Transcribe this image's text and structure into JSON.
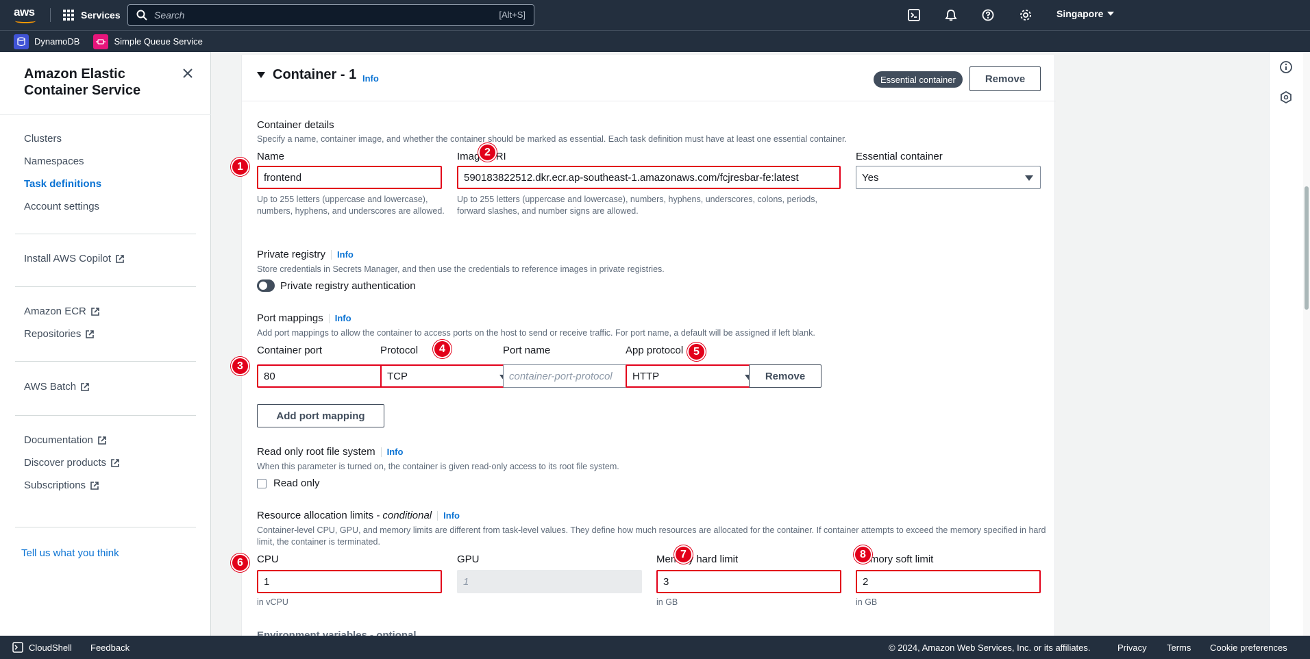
{
  "topnav": {
    "services_label": "Services",
    "search_placeholder": "Search",
    "search_shortcut": "[Alt+S]",
    "region": "Singapore"
  },
  "favorites": [
    {
      "label": "DynamoDB",
      "color": "#4053d6"
    },
    {
      "label": "Simple Queue Service",
      "color": "#e7157b"
    }
  ],
  "sidebar": {
    "title": "Amazon Elastic Container Service",
    "nav": [
      "Clusters",
      "Namespaces",
      "Task definitions",
      "Account settings"
    ],
    "active": "Task definitions",
    "copilot": "Install AWS Copilot",
    "ecr": [
      "Amazon ECR",
      "Repositories"
    ],
    "batch": "AWS Batch",
    "docs": [
      "Documentation",
      "Discover products",
      "Subscriptions"
    ],
    "feedback": "Tell us what you think"
  },
  "container": {
    "title": "Container - 1",
    "info": "Info",
    "essential_badge": "Essential container",
    "remove_label": "Remove",
    "details_heading": "Container details",
    "details_desc": "Specify a name, container image, and whether the container should be marked as essential. Each task definition must have at least one essential container.",
    "name_label": "Name",
    "name_value": "frontend",
    "name_hint": "Up to 255 letters (uppercase and lowercase), numbers, hyphens, and underscores are allowed.",
    "image_label": "Image URI",
    "image_value": "590183822512.dkr.ecr.ap-southeast-1.amazonaws.com/fcjresbar-fe:latest",
    "image_hint": "Up to 255 letters (uppercase and lowercase), numbers, hyphens, underscores, colons, periods, forward slashes, and number signs are allowed.",
    "essential_label": "Essential container",
    "essential_value": "Yes",
    "private_heading": "Private registry",
    "private_desc": "Store credentials in Secrets Manager, and then use the credentials to reference images in private registries.",
    "private_toggle_label": "Private registry authentication",
    "port_heading": "Port mappings",
    "port_desc": "Add port mappings to allow the container to access ports on the host to send or receive traffic. For port name, a default will be assigned if left blank.",
    "container_port_label": "Container port",
    "container_port_value": "80",
    "protocol_label": "Protocol",
    "protocol_value": "TCP",
    "port_name_label": "Port name",
    "port_name_placeholder": "container-port-protocol",
    "app_protocol_label": "App protocol",
    "app_protocol_value": "HTTP",
    "port_remove_label": "Remove",
    "add_port_label": "Add port mapping",
    "readonly_heading": "Read only root file system",
    "readonly_desc": "When this parameter is turned on, the container is given read-only access to its root file system.",
    "readonly_checkbox": "Read only",
    "resource_heading": "Resource allocation limits",
    "resource_conditional": "- conditional",
    "resource_desc": "Container-level CPU, GPU, and memory limits are different from task-level values. They define how much resources are allocated for the container. If container attempts to exceed the memory specified in hard limit, the container is terminated.",
    "cpu_label": "CPU",
    "cpu_value": "1",
    "cpu_hint": "in vCPU",
    "gpu_label": "GPU",
    "gpu_placeholder": "1",
    "mem_hard_label": "Memory hard limit",
    "mem_hard_value": "3",
    "mem_hard_hint": "in GB",
    "mem_soft_label": "Memory soft limit",
    "mem_soft_value": "2",
    "mem_soft_hint": "in GB",
    "env_heading": "Environment variables - optional"
  },
  "markers": [
    "1",
    "2",
    "3",
    "4",
    "5",
    "6",
    "7",
    "8"
  ],
  "footer": {
    "cloudshell": "CloudShell",
    "feedback": "Feedback",
    "copyright": "© 2024, Amazon Web Services, Inc. or its affiliates.",
    "privacy": "Privacy",
    "terms": "Terms",
    "cookies": "Cookie preferences"
  },
  "colors": {
    "accent": "#0972d3",
    "highlight": "#e2001a",
    "nav_bg": "#232f3e"
  }
}
